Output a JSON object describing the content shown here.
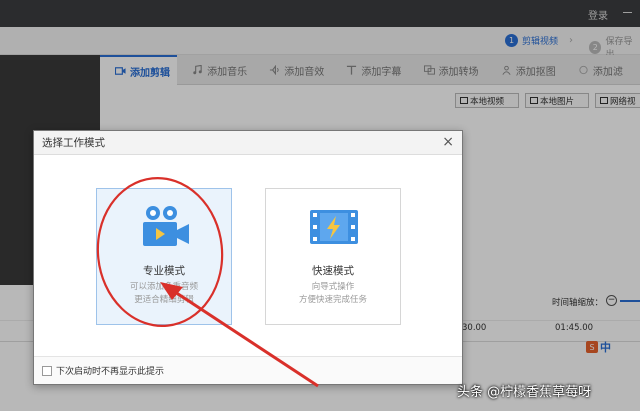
{
  "header": {
    "login": "登录"
  },
  "steps": [
    {
      "num": "1",
      "label": "剪辑视频"
    },
    {
      "num": "2",
      "label": "保存导出"
    }
  ],
  "tabs": [
    {
      "label": "添加剪辑",
      "icon": "video-camera-icon"
    },
    {
      "label": "添加音乐",
      "icon": "music-note-icon"
    },
    {
      "label": "添加音效",
      "icon": "sound-effect-icon"
    },
    {
      "label": "添加字幕",
      "icon": "text-t-icon"
    },
    {
      "label": "添加转场",
      "icon": "transition-icon"
    },
    {
      "label": "添加抠图",
      "icon": "cutout-icon"
    },
    {
      "label": "添加滤",
      "icon": "filter-icon"
    }
  ],
  "media_buttons": [
    {
      "label": "本地视频"
    },
    {
      "label": "本地图片"
    },
    {
      "label": "网络视"
    }
  ],
  "timeline": {
    "zoom_label": "时间轴缩放：",
    "minus": "−",
    "ticks": [
      "30.00",
      "01:45.00"
    ]
  },
  "ime": {
    "s": "S",
    "lang": "中"
  },
  "dialog": {
    "title": "选择工作模式",
    "close": "×",
    "modes": [
      {
        "title": "专业模式",
        "desc1": "可以添加多重音频",
        "desc2": "更适合精细剪辑"
      },
      {
        "title": "快速模式",
        "desc1": "向导式操作",
        "desc2": "方便快速完成任务"
      }
    ],
    "footer": "下次启动时不再显示此提示"
  },
  "watermark": "头条 @柠檬香蕉草莓呀",
  "colors": {
    "accent": "#2a6fd6",
    "icon_blue": "#3d8fe0",
    "annotation_red": "#d9302a",
    "titlebar": "#3c3d40"
  }
}
